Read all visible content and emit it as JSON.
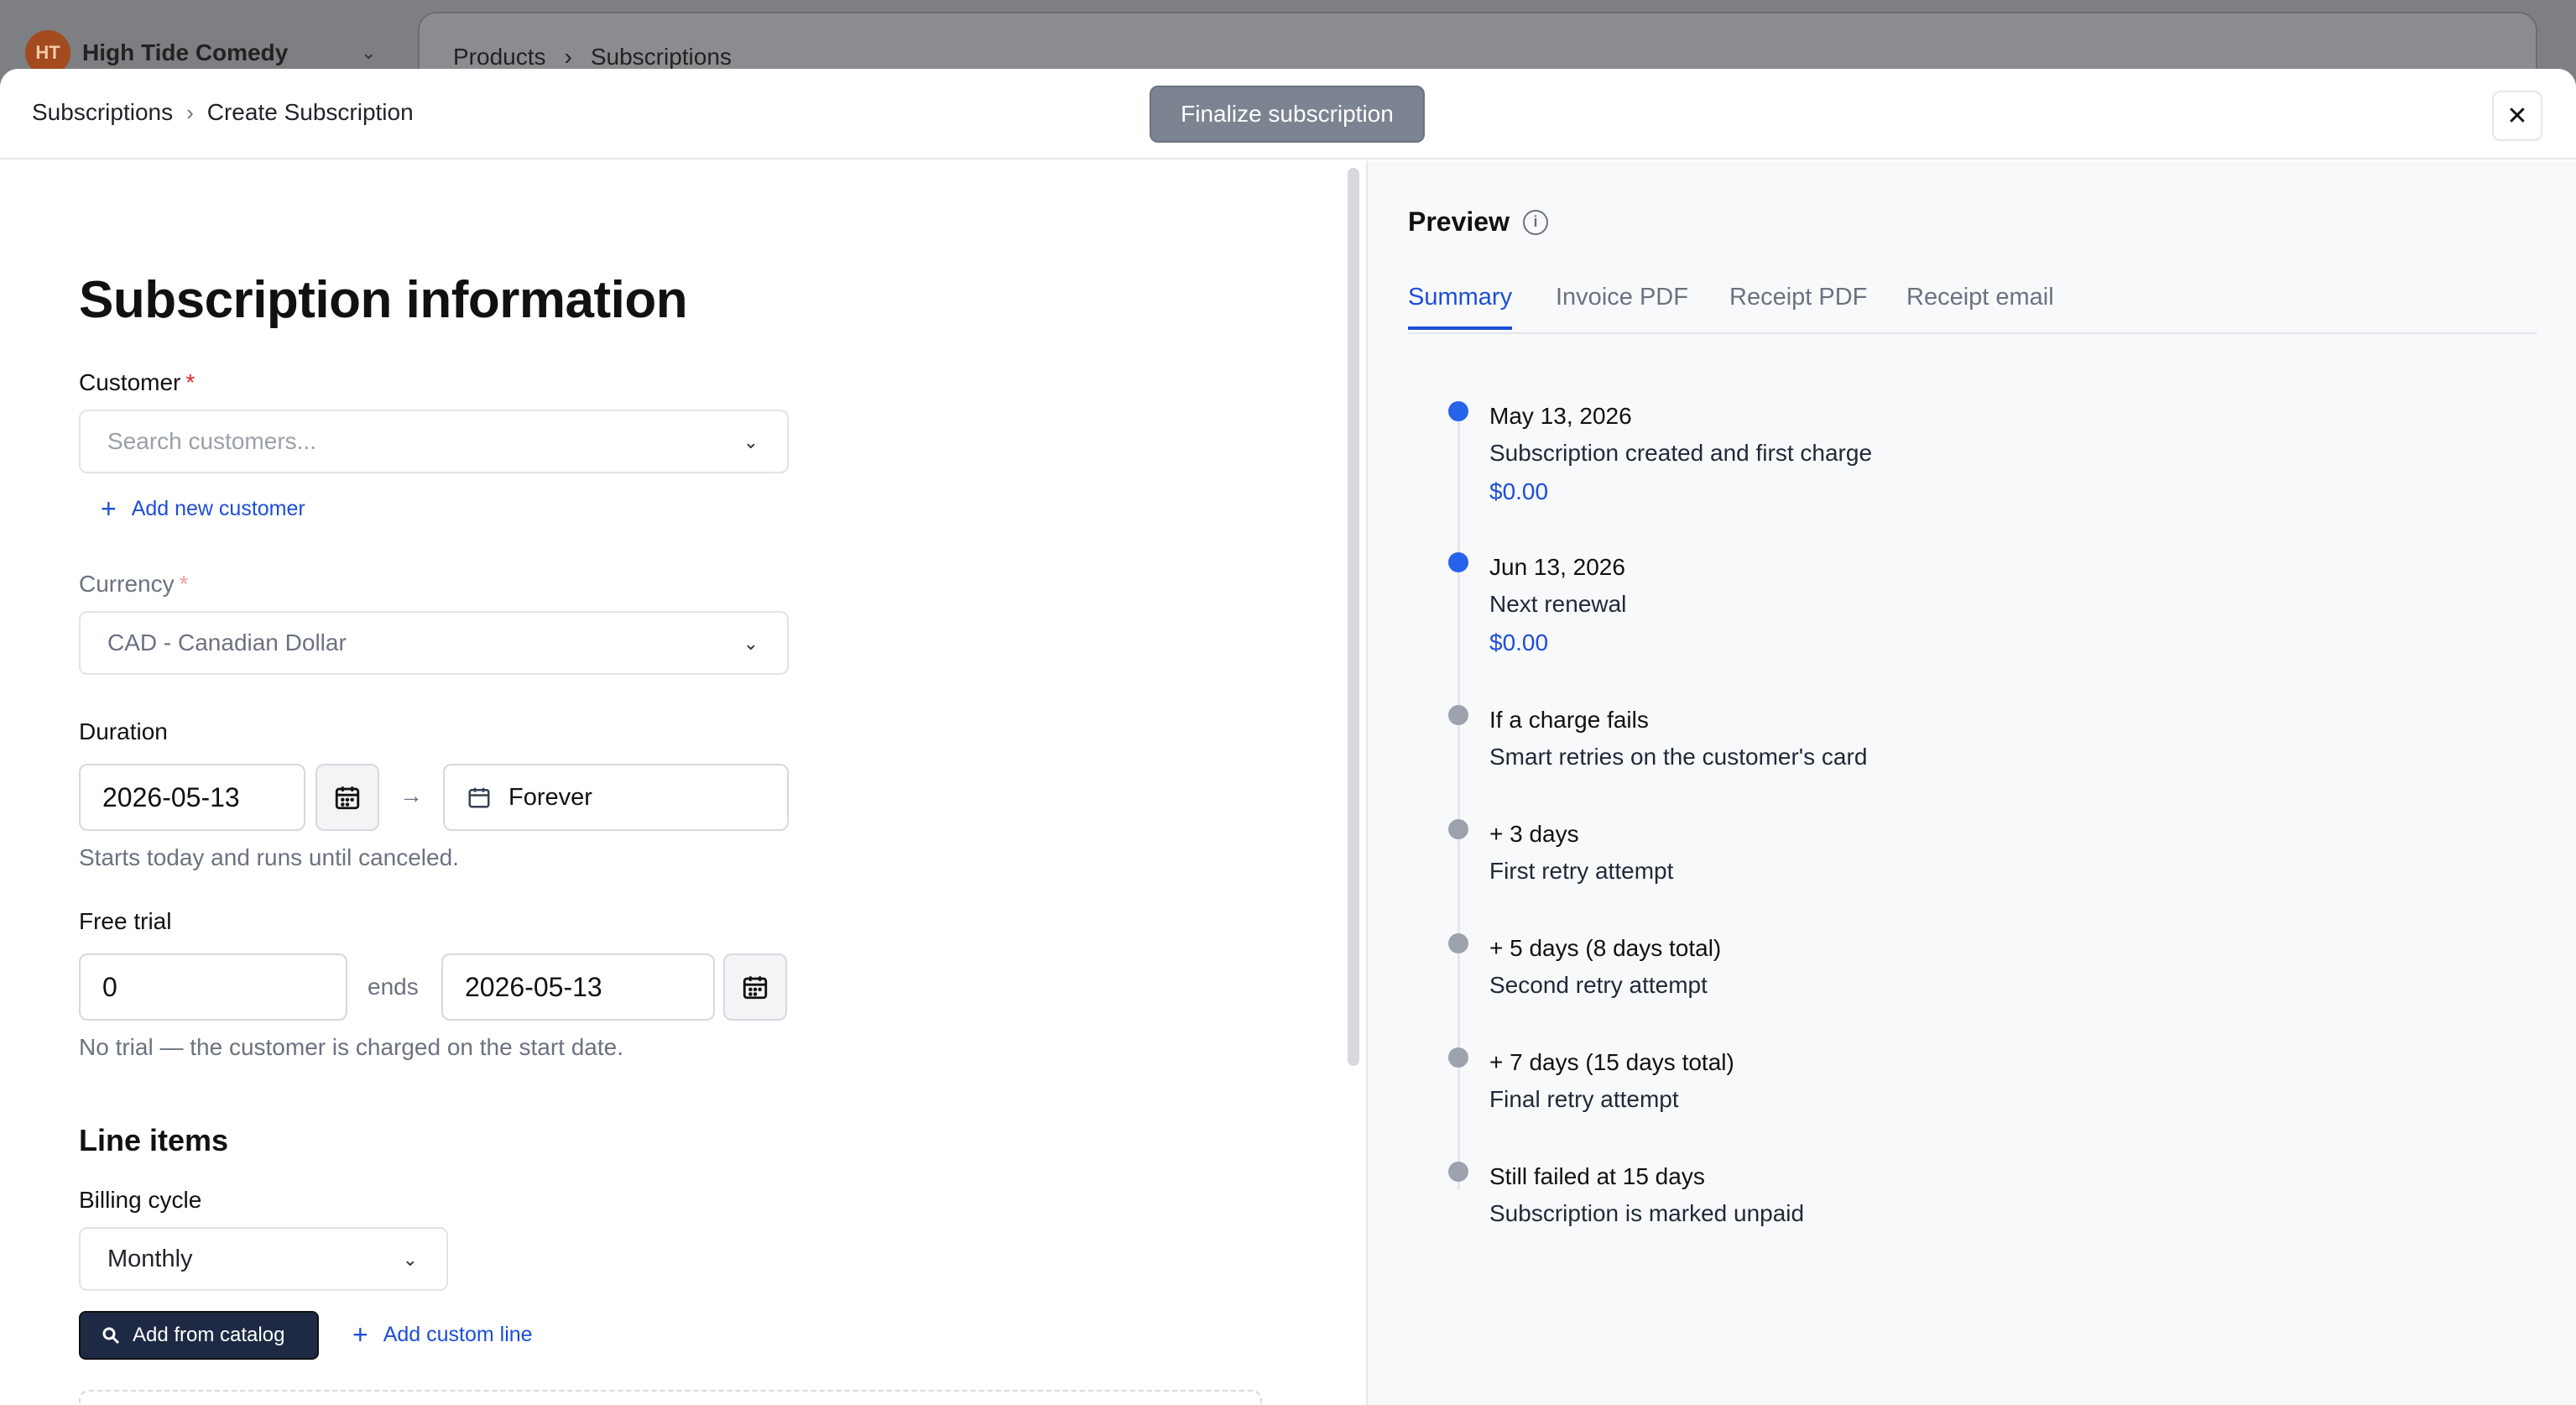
{
  "background": {
    "org_name": "High Tide Comedy",
    "org_initials": "HT",
    "breadcrumb": [
      "Products",
      "Subscriptions"
    ]
  },
  "header": {
    "breadcrumb_parent": "Subscriptions",
    "breadcrumb_current": "Create Subscription",
    "finalize_label": "Finalize subscription"
  },
  "form": {
    "title": "Subscription information",
    "customer": {
      "label": "Customer",
      "placeholder": "Search customers...",
      "add_new_label": "Add new customer"
    },
    "currency": {
      "label": "Currency",
      "value": "CAD - Canadian Dollar"
    },
    "duration": {
      "label": "Duration",
      "start_date": "2026-05-13",
      "end_value": "Forever",
      "helper": "Starts today and runs until canceled."
    },
    "free_trial": {
      "label": "Free trial",
      "days": "0",
      "ends_label": "ends",
      "end_date": "2026-05-13",
      "helper": "No trial — the customer is charged on the start date."
    },
    "line_items": {
      "title": "Line items",
      "billing_cycle_label": "Billing cycle",
      "billing_cycle_value": "Monthly",
      "add_from_catalog": "Add from catalog",
      "add_custom_line": "Add custom line"
    }
  },
  "preview": {
    "title": "Preview",
    "tabs": [
      "Summary",
      "Invoice PDF",
      "Receipt PDF",
      "Receipt email"
    ],
    "active_tab": "Summary",
    "timeline": [
      {
        "title": "May 13, 2026",
        "desc": "Subscription created and first charge",
        "amount": "$0.00",
        "status": "blue"
      },
      {
        "title": "Jun 13, 2026",
        "desc": "Next renewal",
        "amount": "$0.00",
        "status": "blue"
      },
      {
        "title": "If a charge fails",
        "desc": "Smart retries on the customer's card",
        "status": "gray"
      },
      {
        "title": "+ 3 days",
        "desc": "First retry attempt",
        "status": "gray"
      },
      {
        "title": "+ 5 days (8 days total)",
        "desc": "Second retry attempt",
        "status": "gray"
      },
      {
        "title": "+ 7 days (15 days total)",
        "desc": "Final retry attempt",
        "status": "gray"
      },
      {
        "title": "Still failed at 15 days",
        "desc": "Subscription is marked unpaid",
        "status": "gray"
      }
    ]
  },
  "colors": {
    "accent": "#1d4ed8",
    "dot_active": "#2563eb",
    "dot_inactive": "#9ca3af",
    "finalize_bg": "#7c8391",
    "dark_button": "#1e2a44"
  },
  "icons": {
    "close": "close-icon",
    "chevron": "chevron-down-icon",
    "calendar": "calendar-icon",
    "search": "search-icon",
    "plus": "plus-icon",
    "info": "info-icon",
    "arrow": "arrow-right-icon"
  }
}
